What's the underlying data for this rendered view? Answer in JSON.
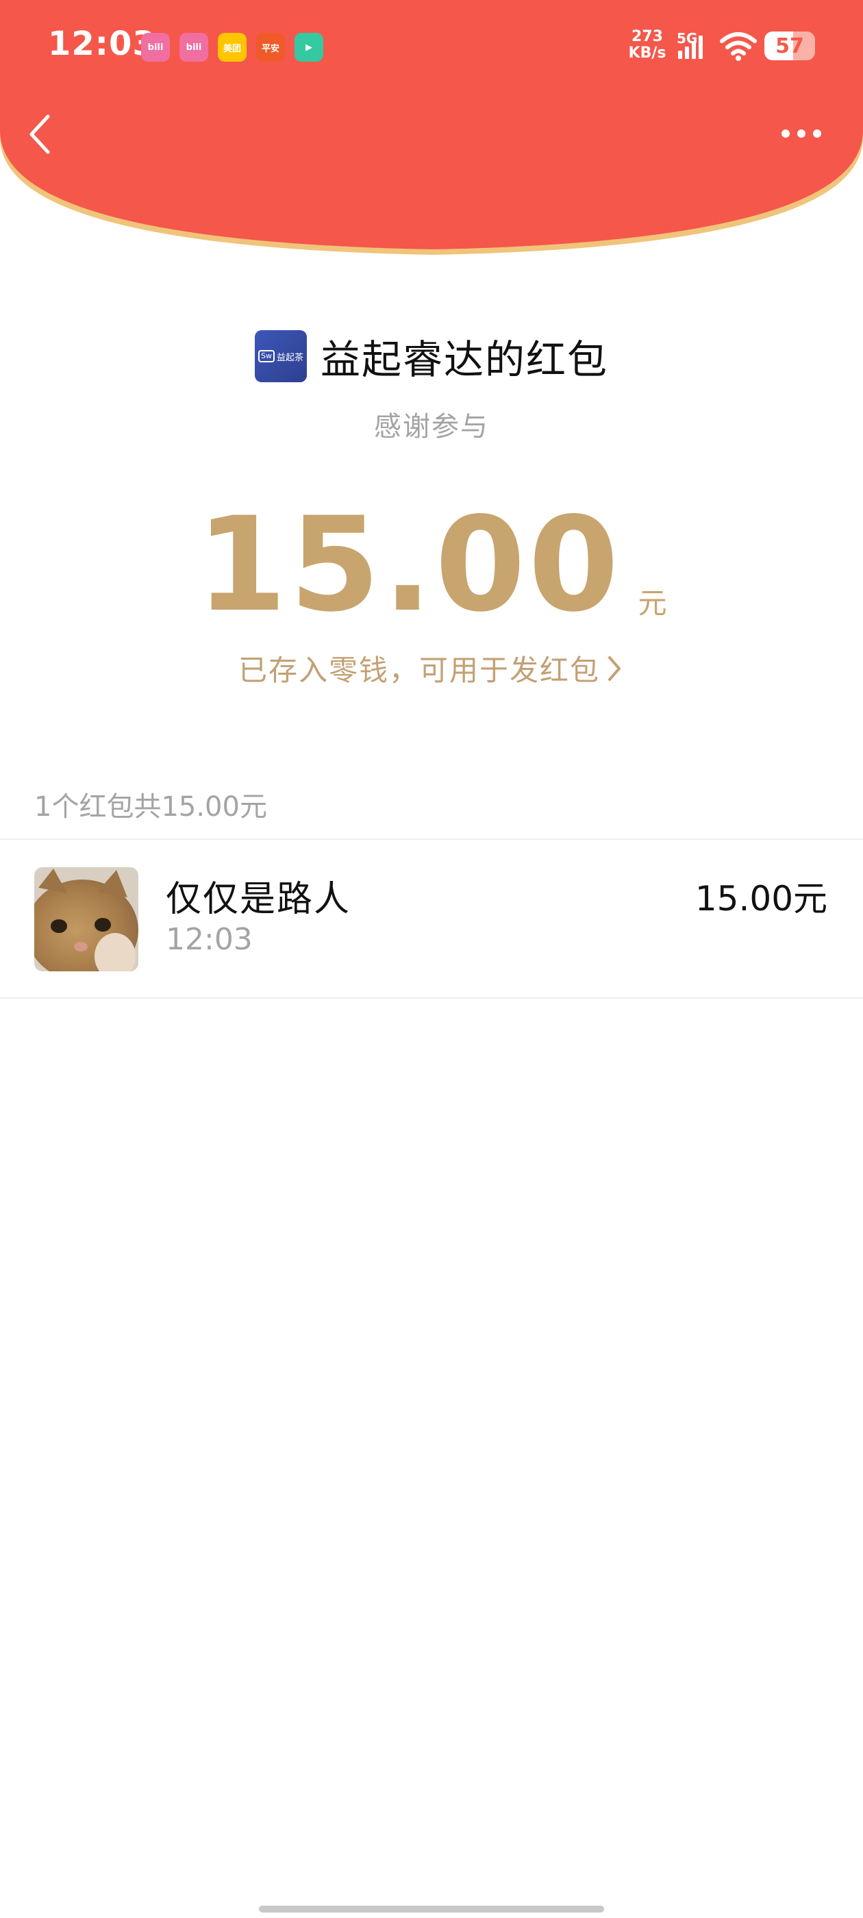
{
  "status_bar": {
    "time": "12:03",
    "app_icons": [
      {
        "name": "bilibili-icon",
        "label": "bili",
        "color": "#f06fa0"
      },
      {
        "name": "bilibili-icon-2",
        "label": "bili",
        "color": "#f06fa0"
      },
      {
        "name": "meituan-icon",
        "label": "美团",
        "color": "#ffc500"
      },
      {
        "name": "pingan-bank-icon",
        "label": "平安",
        "color": "#f05a28"
      },
      {
        "name": "video-app-icon",
        "label": "▶",
        "color": "#34c9a0"
      }
    ],
    "net_speed_value": "273",
    "net_speed_unit": "KB/s",
    "network": "5G",
    "battery": "57",
    "battery_level": 0.57
  },
  "header": {
    "color": "#f5574a",
    "border_color": "#f0c47a"
  },
  "sender": {
    "logo_mark": "Sw",
    "logo_text": "益起茶",
    "title": "益起睿达的红包"
  },
  "blessing": "感谢参与",
  "amount": {
    "value": "15.00",
    "unit": "元",
    "color": "#c8a46e"
  },
  "stored_link": {
    "label": "已存入零钱，可用于发红包",
    "chevron": "›"
  },
  "summary": "1个红包共15.00元",
  "records": [
    {
      "name": "仅仅是路人",
      "time": "12:03",
      "amount": "15.00元",
      "avatar": "cat-avatar"
    }
  ]
}
